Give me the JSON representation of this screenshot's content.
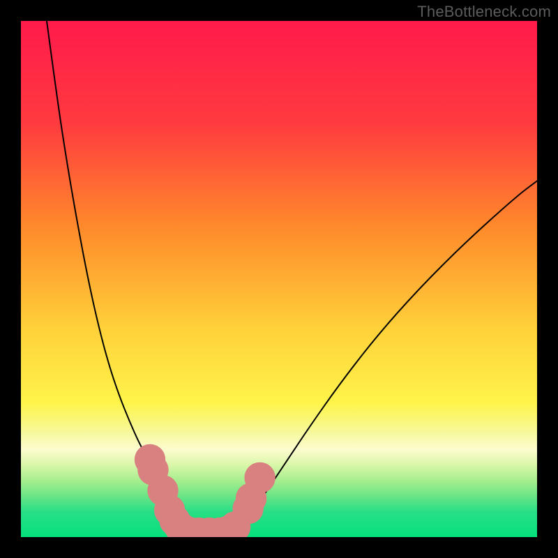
{
  "watermark": "TheBottleneck.com",
  "chart_data": {
    "type": "line",
    "title": "",
    "xlabel": "",
    "ylabel": "",
    "xlim": [
      0,
      100
    ],
    "ylim": [
      0,
      100
    ],
    "background_gradient": {
      "stops": [
        {
          "offset": 0,
          "color": "#ff1a4b"
        },
        {
          "offset": 20,
          "color": "#ff3b3f"
        },
        {
          "offset": 40,
          "color": "#ff8a2b"
        },
        {
          "offset": 60,
          "color": "#ffd23a"
        },
        {
          "offset": 74,
          "color": "#fff44a"
        },
        {
          "offset": 80,
          "color": "#f6f9a0"
        },
        {
          "offset": 83,
          "color": "#fdfccf"
        },
        {
          "offset": 86,
          "color": "#d9f7a9"
        },
        {
          "offset": 89,
          "color": "#a7ee8f"
        },
        {
          "offset": 92,
          "color": "#6ce586"
        },
        {
          "offset": 95,
          "color": "#2adf86"
        },
        {
          "offset": 100,
          "color": "#05e17d"
        }
      ]
    },
    "series": [
      {
        "name": "curve",
        "color": "#000000",
        "width": 2,
        "x": [
          5,
          7,
          9,
          11,
          13,
          15,
          17,
          19,
          21,
          23,
          25,
          27,
          28.5,
          30,
          32,
          34,
          36.5,
          40,
          42,
          44,
          47,
          51,
          56,
          62,
          69,
          77,
          86,
          96,
          100
        ],
        "y": [
          100,
          85,
          72,
          60.5,
          50,
          41,
          33.5,
          27.5,
          22.5,
          18,
          14.5,
          11.5,
          9.5,
          7,
          3.7,
          1.8,
          0.8,
          0.8,
          1.8,
          3.7,
          8,
          14,
          21.5,
          30,
          39,
          48,
          57,
          66,
          69
        ]
      }
    ],
    "markers": {
      "color": "#d98080",
      "radius": 3.0,
      "points": [
        {
          "x": 25.0,
          "y": 15.0
        },
        {
          "x": 25.6,
          "y": 13.0
        },
        {
          "x": 27.5,
          "y": 9.0
        },
        {
          "x": 28.8,
          "y": 5.2
        },
        {
          "x": 29.8,
          "y": 3.2
        },
        {
          "x": 30.8,
          "y": 1.9
        },
        {
          "x": 32.4,
          "y": 1.0
        },
        {
          "x": 34.5,
          "y": 0.8
        },
        {
          "x": 36.5,
          "y": 0.8
        },
        {
          "x": 38.5,
          "y": 0.8
        },
        {
          "x": 40.0,
          "y": 1.1
        },
        {
          "x": 41.5,
          "y": 2.0
        },
        {
          "x": 44.0,
          "y": 5.5
        },
        {
          "x": 44.6,
          "y": 7.5
        },
        {
          "x": 46.3,
          "y": 11.5
        }
      ]
    }
  }
}
